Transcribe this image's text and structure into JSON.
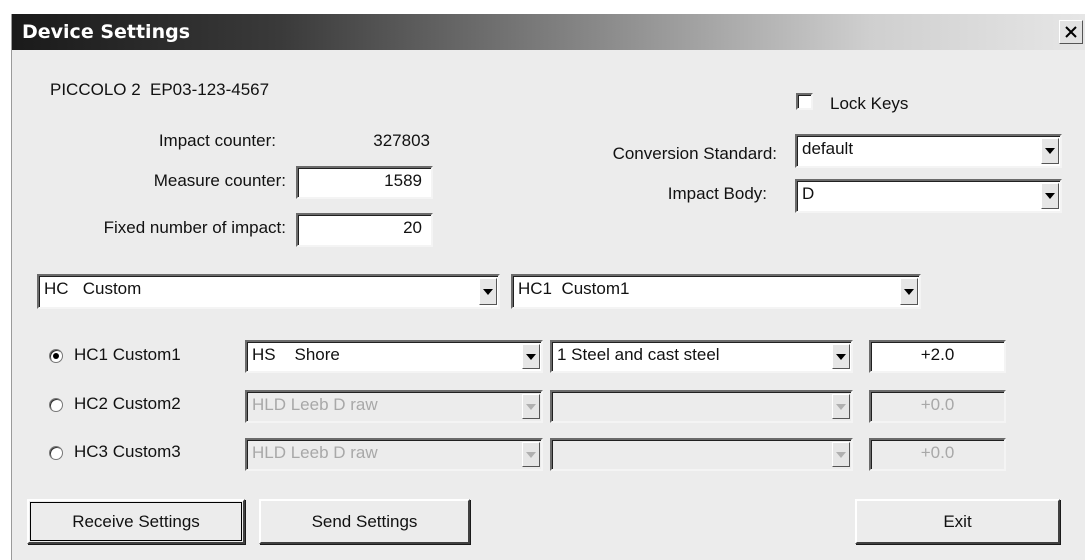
{
  "window": {
    "title": "Device Settings"
  },
  "device": {
    "model": "PICCOLO 2",
    "serial": "EP03-123-4567"
  },
  "lock_keys": {
    "label": "Lock Keys",
    "checked": false
  },
  "counters": {
    "impact_label": "Impact counter:",
    "impact_value": "327803",
    "measure_label": "Measure counter:",
    "measure_value": "1589",
    "fixed_label": "Fixed number of impact:",
    "fixed_value": "20"
  },
  "conversion": {
    "standard_label": "Conversion Standard:",
    "standard_value": "default",
    "body_label": "Impact Body:",
    "body_value": "D"
  },
  "hc_selectors": {
    "left": "HC   Custom",
    "right": "HC1  Custom1"
  },
  "custom_rows": [
    {
      "label": "HC1 Custom1",
      "selected": true,
      "scale": "HS    Shore",
      "material": "1 Steel and cast steel",
      "offset": "+2.0",
      "enabled": true
    },
    {
      "label": "HC2 Custom2",
      "selected": false,
      "scale": "HLD Leeb D raw",
      "material": "",
      "offset": "+0.0",
      "enabled": false
    },
    {
      "label": "HC3 Custom3",
      "selected": false,
      "scale": "HLD Leeb D raw",
      "material": "",
      "offset": "+0.0",
      "enabled": false
    }
  ],
  "buttons": {
    "receive": "Receive Settings",
    "send": "Send Settings",
    "exit": "Exit"
  },
  "icons": {
    "close": "close-icon",
    "dropdown": "chevron-down-icon"
  }
}
